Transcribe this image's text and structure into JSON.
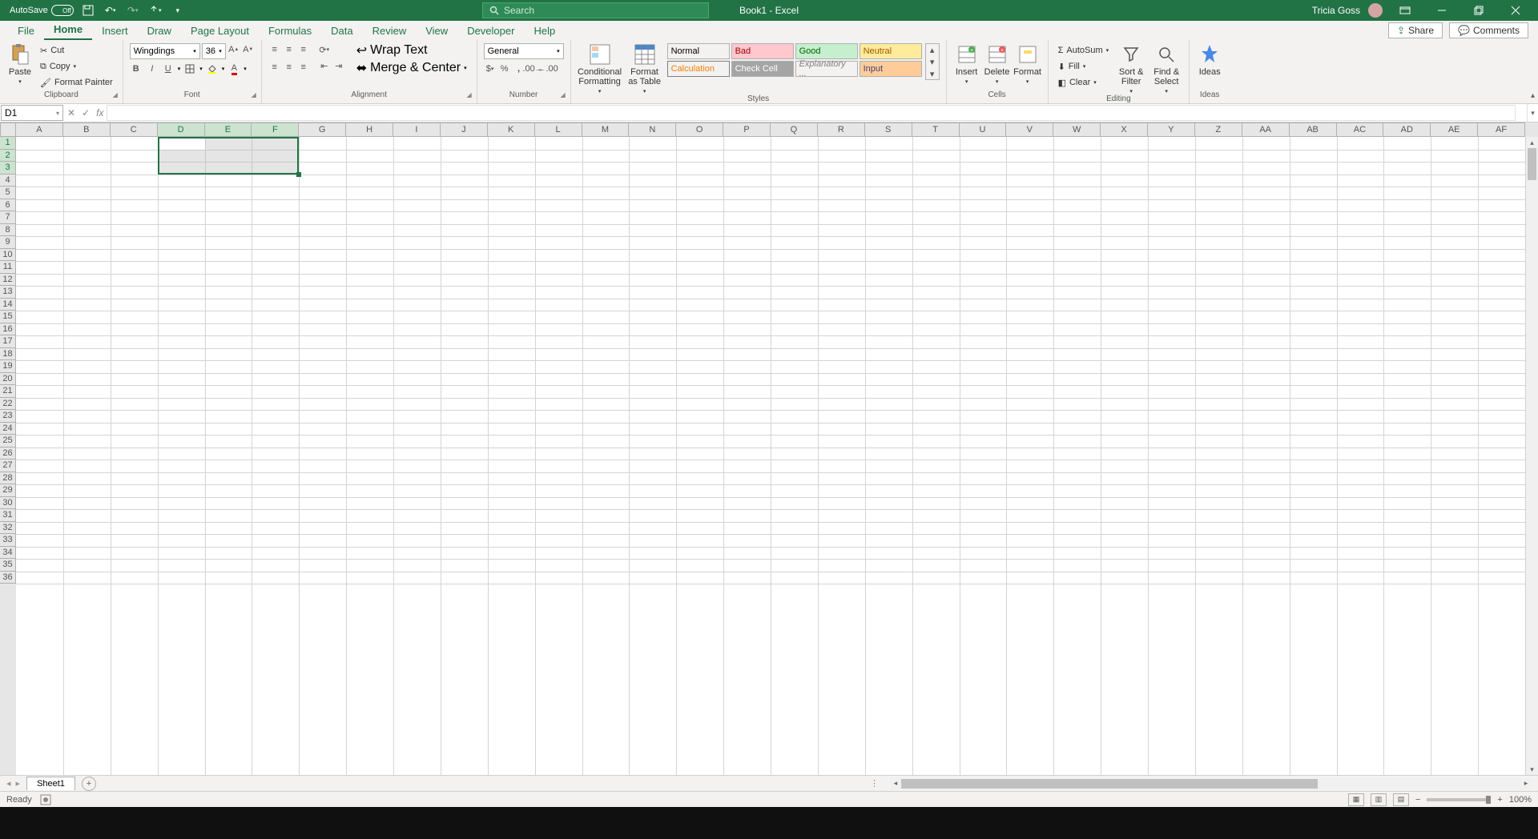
{
  "title_bar": {
    "autosave_label": "AutoSave",
    "autosave_state": "Off",
    "doc_title": "Book1  -  Excel",
    "search_placeholder": "Search",
    "user_name": "Tricia Goss"
  },
  "tabs": {
    "file": "File",
    "home": "Home",
    "insert": "Insert",
    "draw": "Draw",
    "page_layout": "Page Layout",
    "formulas": "Formulas",
    "data": "Data",
    "review": "Review",
    "view": "View",
    "developer": "Developer",
    "help": "Help",
    "share": "Share",
    "comments": "Comments"
  },
  "ribbon": {
    "clipboard": {
      "paste": "Paste",
      "cut": "Cut",
      "copy": "Copy",
      "format_painter": "Format Painter",
      "label": "Clipboard"
    },
    "font": {
      "name": "Wingdings",
      "size": "36",
      "label": "Font"
    },
    "alignment": {
      "wrap": "Wrap Text",
      "merge": "Merge & Center",
      "label": "Alignment"
    },
    "number": {
      "format": "General",
      "label": "Number"
    },
    "styles": {
      "cond": "Conditional Formatting",
      "table": "Format as Table",
      "normal": "Normal",
      "bad": "Bad",
      "good": "Good",
      "neutral": "Neutral",
      "calc": "Calculation",
      "check": "Check Cell",
      "explan": "Explanatory ...",
      "input": "Input",
      "label": "Styles"
    },
    "cells": {
      "insert": "Insert",
      "delete": "Delete",
      "format": "Format",
      "label": "Cells"
    },
    "editing": {
      "autosum": "AutoSum",
      "fill": "Fill",
      "clear": "Clear",
      "sort": "Sort & Filter",
      "find": "Find & Select",
      "label": "Editing"
    },
    "ideas": {
      "ideas": "Ideas",
      "label": "Ideas"
    }
  },
  "name_box": "D1",
  "sheet": {
    "columns": [
      "A",
      "B",
      "C",
      "D",
      "E",
      "F",
      "G",
      "H",
      "I",
      "J",
      "K",
      "L",
      "M",
      "N",
      "O",
      "P",
      "Q",
      "R",
      "S",
      "T",
      "U",
      "V",
      "W",
      "X",
      "Y",
      "Z",
      "AA",
      "AB",
      "AC",
      "AD",
      "AE",
      "AF"
    ],
    "selected_cols": [
      "D",
      "E",
      "F"
    ],
    "rows_visible": 36,
    "selected_rows": [
      1,
      2,
      3
    ],
    "selection_range": "D1:F3",
    "active_cell": "D1",
    "tab_name": "Sheet1"
  },
  "status": {
    "ready": "Ready",
    "zoom": "100%"
  }
}
